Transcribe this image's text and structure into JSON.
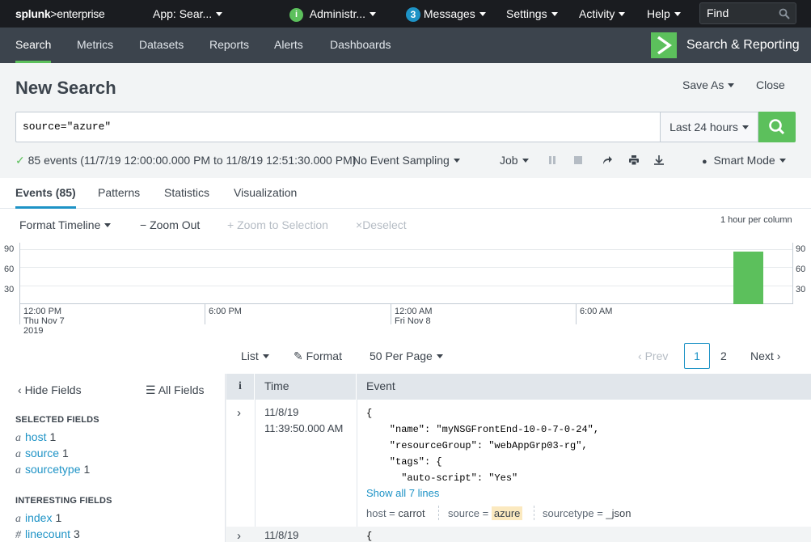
{
  "topbar": {
    "logo_left": "splunk",
    "logo_right": ">enterprise",
    "app_menu": "App: Sear...",
    "admin_badge": "i",
    "admin_label": "Administr...",
    "messages_count": "3",
    "messages_label": "Messages",
    "settings_label": "Settings",
    "activity_label": "Activity",
    "help_label": "Help",
    "find_placeholder": "Find"
  },
  "nav": {
    "tabs": [
      "Search",
      "Metrics",
      "Datasets",
      "Reports",
      "Alerts",
      "Dashboards"
    ],
    "active": "Search",
    "app_title": "Search & Reporting"
  },
  "header": {
    "title": "New Search",
    "save_as": "Save As",
    "close": "Close"
  },
  "search": {
    "query": "source=\"azure\"",
    "time_range": "Last 24 hours"
  },
  "status": {
    "summary": "85 events (11/7/19 12:00:00.000 PM to 11/8/19 12:51:30.000 PM)",
    "sampling": "No Event Sampling",
    "job": "Job",
    "mode": "Smart Mode"
  },
  "result_tabs": [
    "Events (85)",
    "Patterns",
    "Statistics",
    "Visualization"
  ],
  "timeline": {
    "format": "Format Timeline",
    "zoom_out": "Zoom Out",
    "zoom_selection": "Zoom to Selection",
    "deselect": "Deselect",
    "scale_note": "1 hour per column",
    "y_ticks": [
      "90",
      "60",
      "30"
    ],
    "x_labels": [
      {
        "l1": "12:00 PM",
        "l2": "Thu Nov 7",
        "l3": "2019"
      },
      {
        "l1": "6:00 PM",
        "l2": "",
        "l3": ""
      },
      {
        "l1": "12:00 AM",
        "l2": "Fri Nov 8",
        "l3": ""
      },
      {
        "l1": "6:00 AM",
        "l2": "",
        "l3": ""
      }
    ]
  },
  "chart_data": {
    "type": "bar",
    "ylim": [
      0,
      100
    ],
    "y_ticks": [
      30,
      60,
      90
    ],
    "bins_total": 25,
    "bin_index": 23,
    "value": 85
  },
  "results_controls": {
    "list": "List",
    "format": "Format",
    "per_page": "50 Per Page",
    "prev": "Prev",
    "page1": "1",
    "page2": "2",
    "next": "Next"
  },
  "sidebar": {
    "hide_fields": "Hide Fields",
    "all_fields": "All Fields",
    "selected_title": "SELECTED FIELDS",
    "selected": [
      {
        "type": "a",
        "name": "host",
        "count": "1"
      },
      {
        "type": "a",
        "name": "source",
        "count": "1"
      },
      {
        "type": "a",
        "name": "sourcetype",
        "count": "1"
      }
    ],
    "interesting_title": "INTERESTING FIELDS",
    "interesting": [
      {
        "type": "a",
        "name": "index",
        "count": "1"
      },
      {
        "type": "#",
        "name": "linecount",
        "count": "3"
      }
    ]
  },
  "table": {
    "col_info": "i",
    "col_time": "Time",
    "col_event": "Event",
    "rows": [
      {
        "date": "11/8/19",
        "time": "11:39:50.000 AM",
        "lines": [
          "{",
          "    \"name\": \"myNSGFrontEnd-10-0-7-0-24\",",
          "    \"resourceGroup\": \"webAppGrp03-rg\",",
          "    \"tags\": {",
          "      \"auto-script\": \"Yes\""
        ],
        "show_all": "Show all 7 lines",
        "host_k": "host =",
        "host_v": "carrot",
        "source_k": "source =",
        "source_v": "azure",
        "sourcetype_k": "sourcetype =",
        "sourcetype_v": "_json"
      },
      {
        "date": "11/8/19",
        "first_line": "{"
      }
    ]
  }
}
